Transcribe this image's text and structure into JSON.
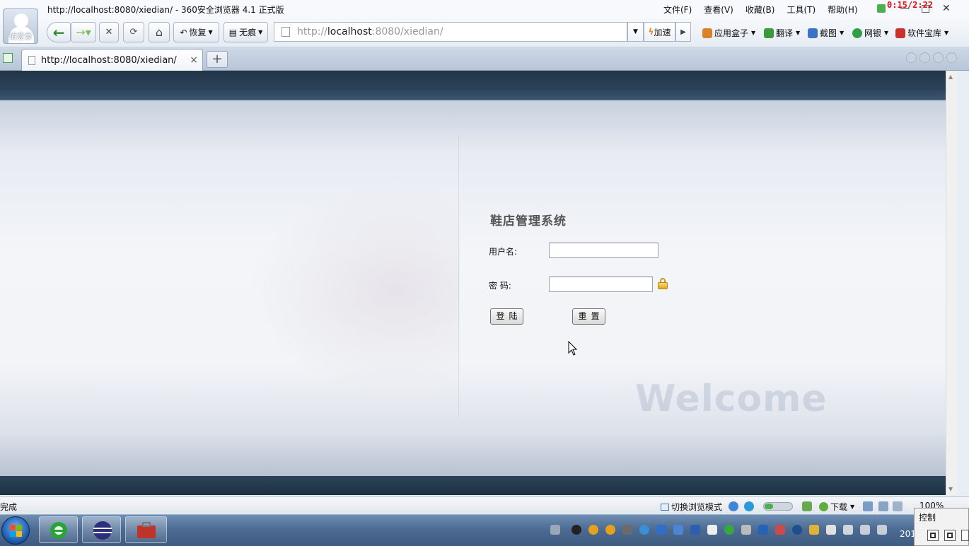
{
  "window": {
    "title": "http://localhost:8080/xiedian/ - 360安全浏览器 4.1 正式版",
    "login_label": "请登录",
    "clock": "0:15/2:22",
    "menus": [
      "文件(F)",
      "查看(V)",
      "收藏(B)",
      "工具(T)",
      "帮助(H)"
    ],
    "controls": {
      "minimize": "—",
      "maximize": "□",
      "close": "✕"
    }
  },
  "toolbar": {
    "back_icon": "back-arrow-icon",
    "forward_icon": "forward-arrow-icon",
    "stop_glyph": "✕",
    "refresh_glyph": "⟳",
    "home_glyph": "⌂",
    "restore_label": "恢复",
    "incognito_label": "无痕",
    "address": {
      "scheme": "http://",
      "host": "localhost",
      "rest": ":8080/xiedian/"
    },
    "accelerate_label": "加速",
    "extensions": [
      {
        "label": "应用盒子",
        "icon": "app-box-icon",
        "color": "#d9822b"
      },
      {
        "label": "翻译",
        "icon": "translate-icon",
        "color": "#3a9a3a"
      },
      {
        "label": "截图",
        "icon": "screenshot-icon",
        "color": "#3b73c4"
      },
      {
        "label": "网银",
        "icon": "bank-icon",
        "color": "#2f9e44"
      },
      {
        "label": "软件宝库",
        "icon": "software-icon",
        "color": "#c8322d"
      }
    ]
  },
  "tabs": [
    {
      "title": "http://localhost:8080/xiedian/",
      "close": "×"
    }
  ],
  "new_tab_glyph": "+",
  "page": {
    "system_name": "鞋店管理系统",
    "username_label": "用户名:",
    "username_value": "",
    "password_label": "密 码:",
    "password_value": "",
    "login_button": "登陆",
    "reset_button": "重置",
    "watermark": "Welcome"
  },
  "statusbar": {
    "text": "完成",
    "mode_label": "切换浏览模式",
    "download_label": "下载",
    "zoom": "100%"
  },
  "taskbar": {
    "apps": [
      "ie-browser-icon",
      "eclipse-icon",
      "toolbox-icon"
    ],
    "control_label": "控制",
    "year_partial": "201"
  },
  "colors": {
    "header_band": "#223547",
    "accent_red": "#d11111"
  }
}
